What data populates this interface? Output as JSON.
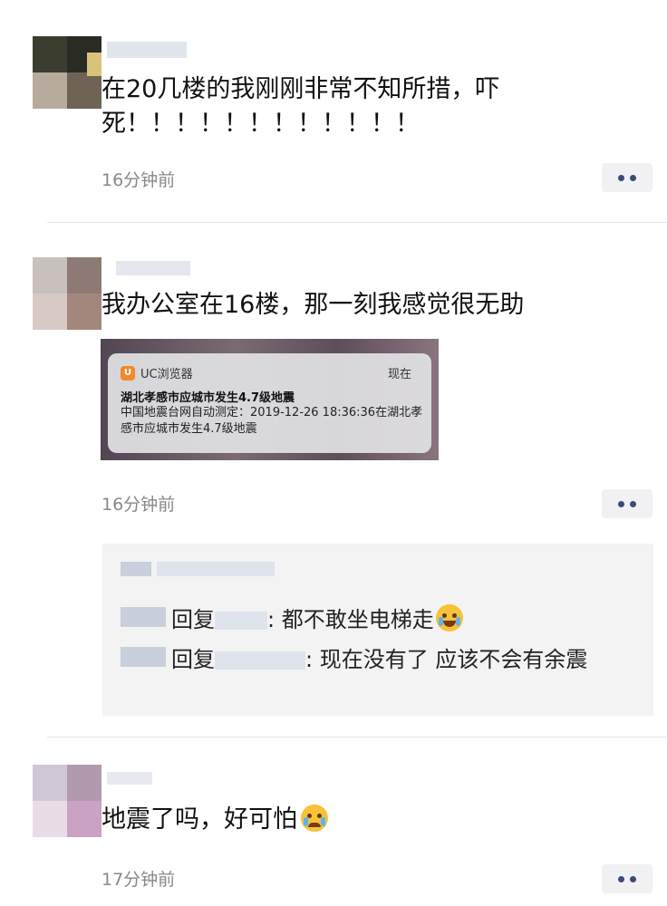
{
  "comments": [
    {
      "username": "",
      "text": "在20几楼的我刚刚非常不知所措，吓死！！！！！！！！！！！！",
      "time": "16分钟前"
    },
    {
      "username": "",
      "text": "我办公室在16楼，那一刻我感觉很无助",
      "time": "16分钟前",
      "image": {
        "app_name": "UC浏览器",
        "when": "现在",
        "title": "湖北孝感市应城市发生4.7级地震",
        "body": "中国地震台网自动测定：2019-12-26 18:36:36在湖北孝感市应城市发生4.7级地震"
      },
      "replies": [
        {
          "author": "",
          "prefix": "回复",
          "target": "",
          "text": ": 都不敢坐电梯走"
        },
        {
          "author": "",
          "prefix": "回复",
          "target": "",
          "text": ": 现在没有了 应该不会有余震"
        }
      ]
    },
    {
      "username": "",
      "text": "地震了吗，好可怕",
      "time": "17分钟前"
    }
  ],
  "icons": {
    "more": "more-dots-icon",
    "laugh_cry": "tears-of-joy-emoji",
    "crying": "crying-emoji"
  },
  "colors": {
    "username": "#2b4d9a",
    "time": "#888888",
    "reply_bg": "#f3f3f4"
  }
}
